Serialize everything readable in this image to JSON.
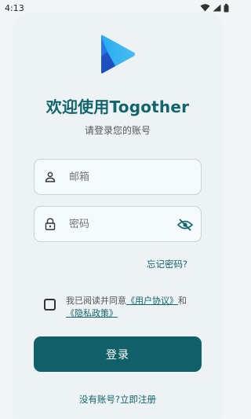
{
  "status_bar": {
    "time": "4:13",
    "icons": [
      "wifi-icon",
      "signal-icon",
      "battery-icon"
    ]
  },
  "app": {
    "logo_icon": "play-logo-icon",
    "title": "欢迎使用Togother",
    "subtitle": "请登录您的账号"
  },
  "form": {
    "email": {
      "placeholder": "邮箱",
      "icon": "person-icon"
    },
    "password": {
      "placeholder": "密码",
      "icon": "lock-icon",
      "toggle_icon": "eye-off-icon"
    },
    "forgot_label": "忘记密码?",
    "agree_prefix": "我已阅读并同意",
    "user_agreement": "《用户协议》",
    "agree_and": "和",
    "privacy_policy": "《隐私政策》",
    "agree_checked": false,
    "login_label": "登录",
    "register_label": "没有账号?立即注册"
  },
  "colors": {
    "primary": "#116069",
    "title": "#14646b",
    "background": "#f3f6f7",
    "card": "#edf3f5"
  }
}
